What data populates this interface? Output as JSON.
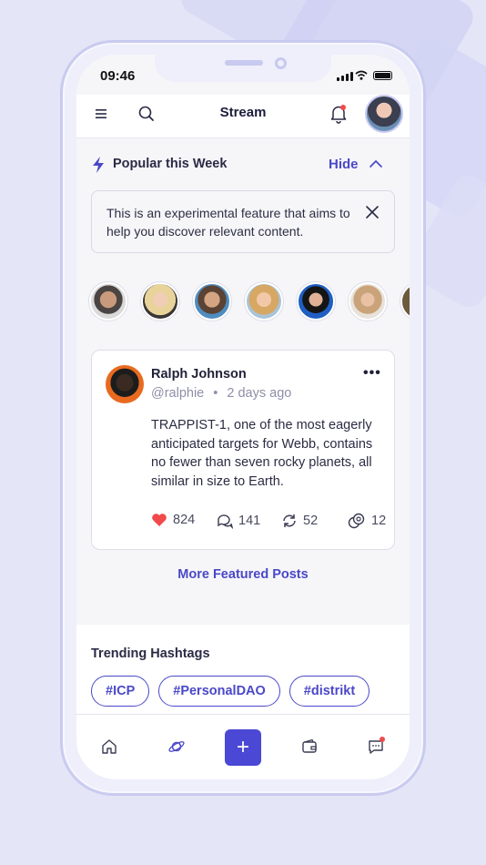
{
  "status_bar": {
    "time": "09:46"
  },
  "header": {
    "title": "Stream",
    "menu_icon": "hamburger-icon",
    "search_icon": "search-icon",
    "bell_icon": "bell-icon"
  },
  "popular": {
    "title": "Popular this Week",
    "hide_label": "Hide"
  },
  "notice": {
    "text": "This is an experimental feature that aims to help you discover relevant content."
  },
  "post": {
    "author": "Ralph Johnson",
    "handle": "@ralphie",
    "separator": "•",
    "time_ago": "2 days ago",
    "body": "TRAPPIST-1, one of the most eagerly anticipated targets for Webb, contains no fewer than seven rocky planets, all similar in size to Earth.",
    "likes": "824",
    "comments": "141",
    "reposts": "52",
    "tips": "12",
    "more_glyph": "•••"
  },
  "more_link": "More Featured Posts",
  "trending": {
    "title": "Trending Hashtags",
    "tags": [
      "#ICP",
      "#PersonalDAO",
      "#distrikt"
    ]
  },
  "tabbar": {
    "plus": "+"
  },
  "colors": {
    "accent": "#4a48c8",
    "like_red": "#f04a4a",
    "background": "#e4e5f7"
  }
}
